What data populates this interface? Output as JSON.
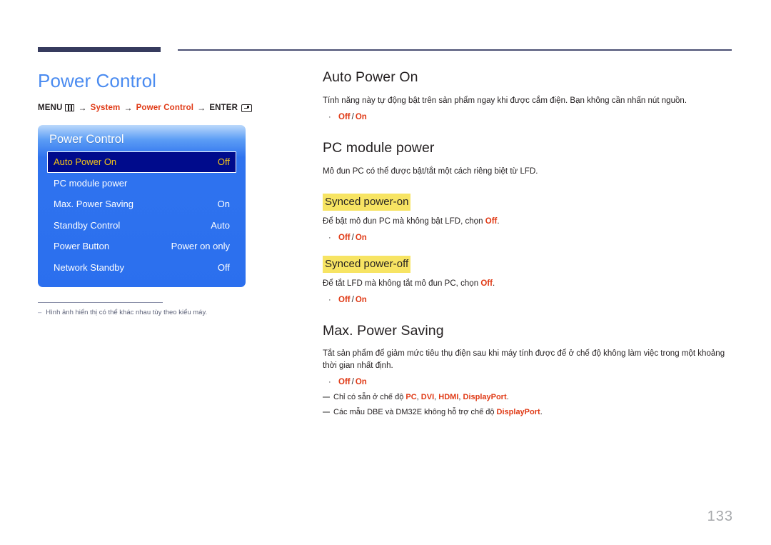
{
  "page": {
    "number": "133"
  },
  "left": {
    "title": "Power Control",
    "breadcrumb": {
      "menu_label": "MENU",
      "menu_icon": "menu-grid-icon",
      "arrow": "→",
      "item1": "System",
      "item2": "Power Control",
      "enter_label": "ENTER",
      "enter_icon": "enter-return-icon"
    },
    "osd": {
      "title": "Power Control",
      "rows": [
        {
          "label": "Auto Power On",
          "value": "Off",
          "selected": true
        },
        {
          "label": "PC module power",
          "value": "",
          "selected": false
        },
        {
          "label": "Max. Power Saving",
          "value": "On",
          "selected": false
        },
        {
          "label": "Standby Control",
          "value": "Auto",
          "selected": false
        },
        {
          "label": "Power Button",
          "value": "Power on only",
          "selected": false
        },
        {
          "label": "Network Standby",
          "value": "Off",
          "selected": false
        }
      ]
    },
    "note": {
      "dash": "–",
      "text": "Hình ảnh hiển thị có thể khác nhau tùy theo kiểu máy."
    }
  },
  "right": {
    "sections": [
      {
        "heading": "Auto Power On",
        "body": "Tính năng này tự động bật trên sản phẩm ngay khi được cắm điện. Bạn không cần nhấn nút nguồn.",
        "bullet": {
          "off": "Off",
          "sep": "/",
          "on": "On"
        }
      },
      {
        "heading": "PC module power",
        "body": "Mô đun PC có thể được bật/tắt một cách riêng biệt từ LFD."
      },
      {
        "highlight": "Synced power-on",
        "body_pre": "Để bật mô đun PC mà không bật LFD, chọn ",
        "body_red": "Off",
        "body_post": ".",
        "bullet": {
          "off": "Off",
          "sep": "/",
          "on": "On"
        }
      },
      {
        "highlight": "Synced power-off",
        "body_pre": "Để tắt LFD mà không tắt mô đun PC, chọn ",
        "body_red": "Off",
        "body_post": ".",
        "bullet": {
          "off": "Off",
          "sep": "/",
          "on": "On"
        }
      },
      {
        "heading": "Max. Power Saving",
        "body": "Tắt sản phẩm để giảm mức tiêu thụ điện sau khi máy tính được để ở chế độ không làm việc trong một khoảng thời gian nhất định.",
        "bullet": {
          "off": "Off",
          "sep": "/",
          "on": "On"
        }
      }
    ],
    "notes": [
      {
        "pre": "Chỉ có sẵn ở chế độ ",
        "r1": "PC",
        "s1": ", ",
        "r2": "DVI",
        "s2": ", ",
        "r3": "HDMI",
        "s3": ", ",
        "r4": "DisplayPort",
        "post": "."
      },
      {
        "pre": "Các mẫu DBE và DM32E không hỗ trợ chế độ ",
        "r1": "DisplayPort",
        "post": "."
      }
    ]
  },
  "colors": {
    "title_blue": "#4a8bf0",
    "accent_red": "#e03a16",
    "highlight_yellow": "#f7e463",
    "osd_blue": "#2b6fee",
    "osd_selected": "#000b8c",
    "osd_selected_text": "#f5c518",
    "rule_navy": "#363b5e",
    "page_num_gray": "#a7a9ac"
  }
}
